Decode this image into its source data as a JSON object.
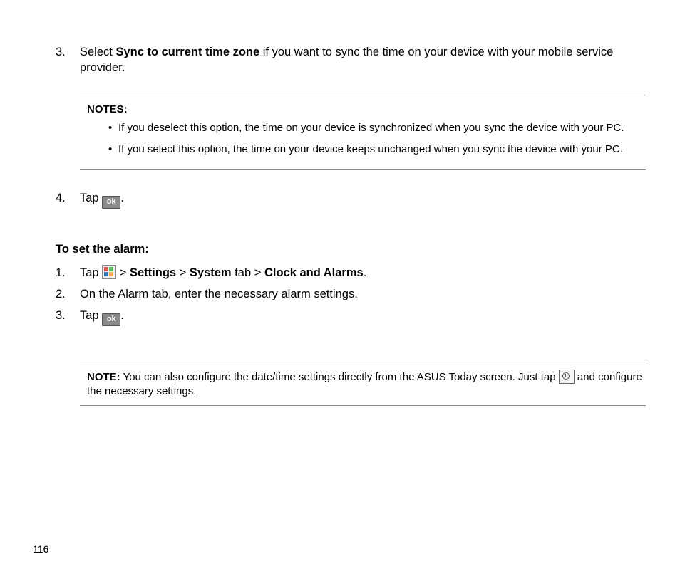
{
  "step3": {
    "num": "3.",
    "pre": "Select ",
    "bold": "Sync to current time zone",
    "post": " if you want to sync the time on your device with your mobile service provider."
  },
  "notes": {
    "title": "NOTES:",
    "b1": "If you deselect this option, the time on your device is synchronized when you sync the device with your PC.",
    "b2": "If you select this option, the time on your device keeps unchanged when you sync the device with your PC."
  },
  "step4": {
    "num": "4.",
    "pre": "Tap ",
    "post": "."
  },
  "alarmHead": "To set the alarm:",
  "a1": {
    "num": "1.",
    "pre": "Tap ",
    "gt1": " > ",
    "b1": "Settings",
    "gt2": " > ",
    "b2": "System",
    "mid": " tab > ",
    "b3": "Clock and Alarms",
    "post": "."
  },
  "a2": {
    "num": "2.",
    "text": "On the Alarm tab, enter the necessary alarm settings."
  },
  "a3": {
    "num": "3.",
    "pre": "Tap ",
    "post": "."
  },
  "note2": {
    "label": "NOTE:",
    "pre": "    You can also configure the date/time settings directly from the ASUS Today screen. Just tap ",
    "post": " and configure the necessary settings."
  },
  "icons": {
    "ok": "ok"
  },
  "pageNumber": "116"
}
